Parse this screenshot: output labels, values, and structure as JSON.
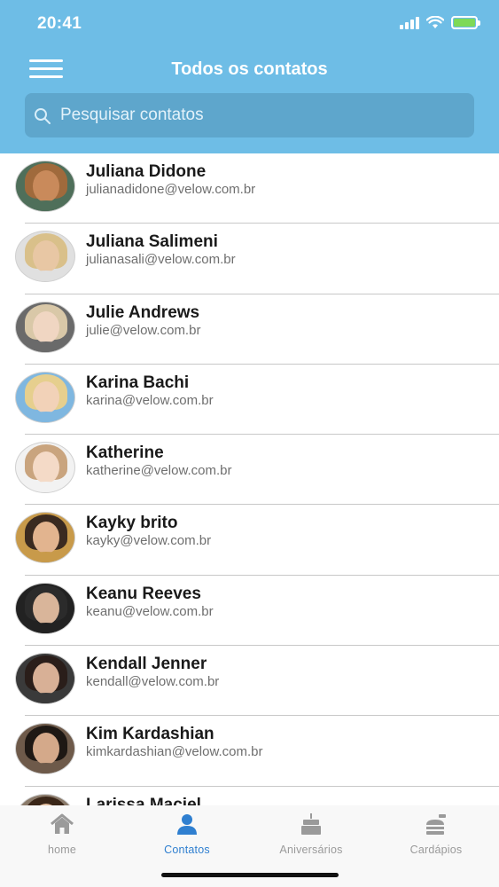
{
  "status_bar": {
    "time": "20:41"
  },
  "header": {
    "title": "Todos os contatos"
  },
  "search": {
    "placeholder": "Pesquisar contatos"
  },
  "contacts": [
    {
      "name": "Juliana Didone",
      "email": "julianadidone@velow.com.br"
    },
    {
      "name": "Juliana Salimeni",
      "email": "julianasali@velow.com.br"
    },
    {
      "name": "Julie Andrews",
      "email": "julie@velow.com.br"
    },
    {
      "name": "Karina Bachi",
      "email": "karina@velow.com.br"
    },
    {
      "name": "Katherine",
      "email": "katherine@velow.com.br"
    },
    {
      "name": "Kayky brito",
      "email": "kayky@velow.com.br"
    },
    {
      "name": "Keanu Reeves",
      "email": "keanu@velow.com.br"
    },
    {
      "name": "Kendall Jenner",
      "email": "kendall@velow.com.br"
    },
    {
      "name": "Kim Kardashian",
      "email": "kimkardashian@velow.com.br"
    },
    {
      "name": "Larissa Maciel",
      "email": ""
    }
  ],
  "tabs": [
    {
      "label": "home",
      "icon": "house-icon",
      "active": false
    },
    {
      "label": "Contatos",
      "icon": "person-icon",
      "active": true
    },
    {
      "label": "Aniversários",
      "icon": "cake-icon",
      "active": false
    },
    {
      "label": "Cardápios",
      "icon": "food-icon",
      "active": false
    }
  ],
  "colors": {
    "header_bg": "#6ebde6",
    "search_bg": "#5ea6cc",
    "active_tab": "#2f7fd0",
    "inactive_tab": "#9a9a9a",
    "battery": "#7ed957"
  }
}
